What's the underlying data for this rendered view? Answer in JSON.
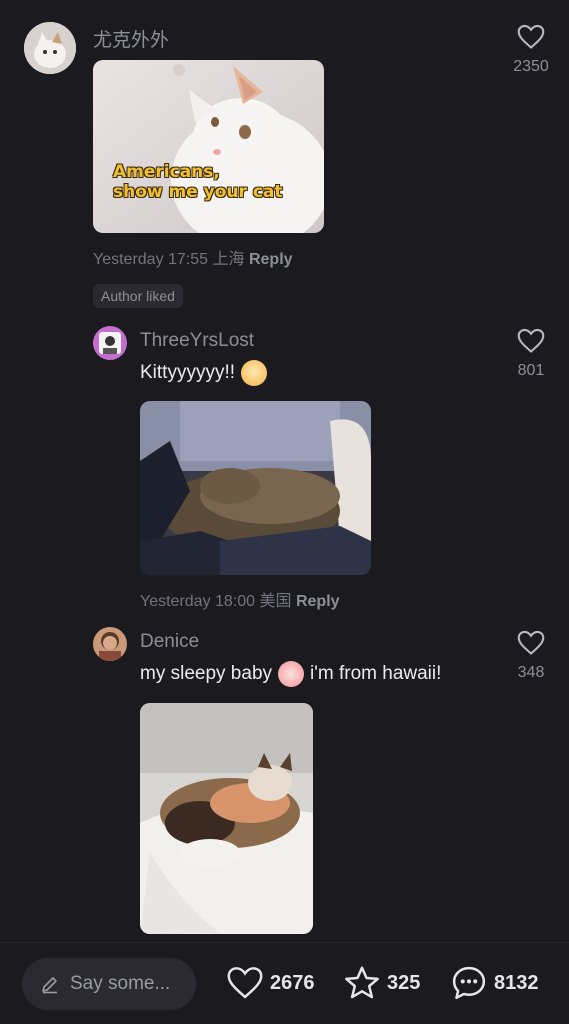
{
  "comments": [
    {
      "username": "尤克外外",
      "image_caption_line1": "Americans,",
      "image_caption_line2": "show me your cat",
      "meta_time": "Yesterday 17:55 上海",
      "reply_label": "Reply",
      "likes": "2350",
      "badge": "Author liked"
    },
    {
      "username": "ThreeYrsLost",
      "text": "Kittyyyyyy!!",
      "meta_time": "Yesterday 18:00 美国",
      "reply_label": "Reply",
      "likes": "801"
    },
    {
      "username": "Denice",
      "text_before": "my sleepy baby",
      "text_after": "i'm from hawaii!",
      "likes": "348"
    }
  ],
  "bottom_bar": {
    "input_placeholder": "Say some...",
    "likes": "2676",
    "stars": "325",
    "comments": "8132"
  },
  "icons": {
    "heart": "heart-icon",
    "star": "star-icon",
    "comment": "comment-bubble-icon",
    "pencil": "pencil-icon"
  },
  "colors": {
    "background": "#1a1a1f",
    "muted_text": "#8e8e96",
    "primary_text": "#ececf0"
  }
}
